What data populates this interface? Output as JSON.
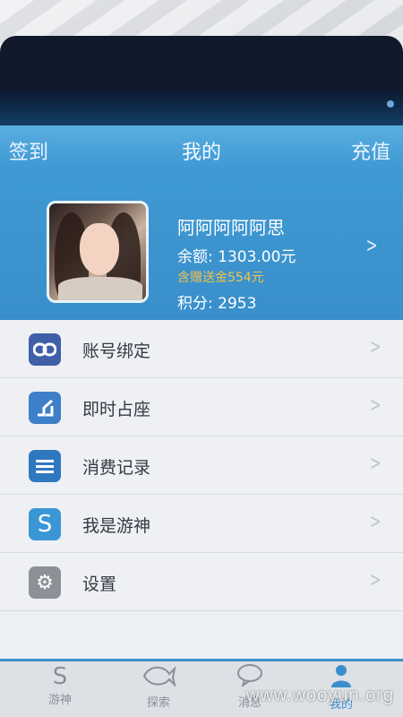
{
  "navbar": {
    "left_label": "签到",
    "title": "我的",
    "right_label": "充值"
  },
  "profile": {
    "username": "阿阿阿阿阿思",
    "balance": "余额: 1303.00元",
    "bonus": "含赠送金554元",
    "points": "积分: 2953"
  },
  "menu": {
    "items": [
      {
        "label": "账号绑定",
        "icon": "link-icon"
      },
      {
        "label": "即时占座",
        "icon": "seat-icon"
      },
      {
        "label": "消费记录",
        "icon": "list-icon"
      },
      {
        "label": "我是游神",
        "icon": "s-logo-icon"
      },
      {
        "label": "设置",
        "icon": "gear-icon"
      }
    ]
  },
  "tabbar": {
    "tabs": [
      {
        "label": "游神",
        "icon": "s-logo-icon"
      },
      {
        "label": "探索",
        "icon": "fish-icon"
      },
      {
        "label": "消息",
        "icon": "chat-bubble-icon"
      },
      {
        "label": "我的",
        "icon": "person-icon"
      }
    ]
  },
  "watermark": "www.wooyun.org",
  "colors": {
    "accent": "#3a8fcb",
    "bonus": "#f2c24b"
  }
}
